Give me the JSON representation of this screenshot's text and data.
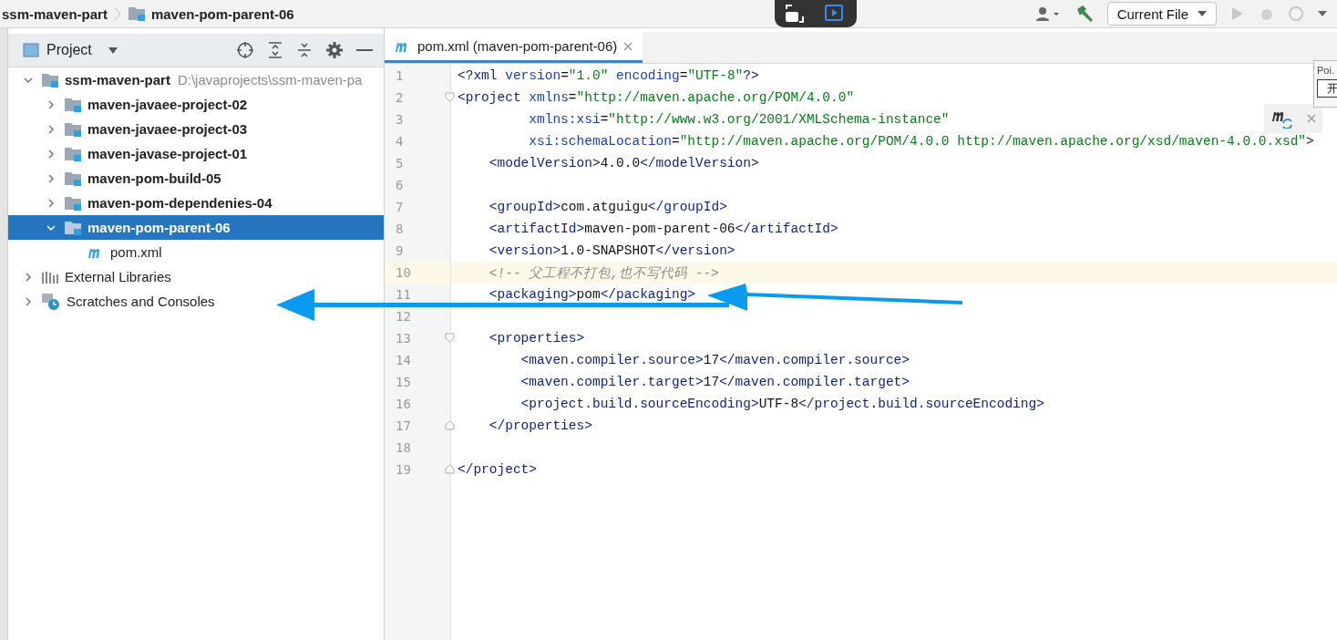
{
  "breadcrumbs": [
    {
      "label": "ssm-maven-part",
      "kind": "text"
    },
    {
      "label": "maven-pom-parent-06",
      "kind": "folder"
    }
  ],
  "toolbar": {
    "run_config": "Current File"
  },
  "project_panel": {
    "title": "Project",
    "tree": [
      {
        "label": "ssm-maven-part",
        "path": "D:\\javaprojects\\ssm-maven-pa",
        "kind": "module",
        "bold": true,
        "expanded": true,
        "selected": false,
        "children": [
          {
            "label": "maven-javaee-project-02",
            "kind": "module",
            "bold": true,
            "expanded": false,
            "selected": false
          },
          {
            "label": "maven-javaee-project-03",
            "kind": "module",
            "bold": true,
            "expanded": false,
            "selected": false
          },
          {
            "label": "maven-javase-project-01",
            "kind": "module",
            "bold": true,
            "expanded": false,
            "selected": false
          },
          {
            "label": "maven-pom-build-05",
            "kind": "module",
            "bold": true,
            "expanded": false,
            "selected": false
          },
          {
            "label": "maven-pom-dependenies-04",
            "kind": "module",
            "bold": true,
            "expanded": false,
            "selected": false
          },
          {
            "label": "maven-pom-parent-06",
            "kind": "module",
            "bold": true,
            "expanded": true,
            "selected": true,
            "children": [
              {
                "label": "pom.xml",
                "kind": "pom",
                "bold": false,
                "selected": false
              }
            ]
          }
        ]
      },
      {
        "label": "External Libraries",
        "kind": "libraries",
        "bold": false,
        "expanded": false,
        "selected": false
      },
      {
        "label": "Scratches and Consoles",
        "kind": "scratches",
        "bold": false,
        "expanded": false,
        "selected": false
      }
    ]
  },
  "editor": {
    "tab": {
      "label": "pom.xml (maven-pom-parent-06)",
      "selected": true
    },
    "lines": [
      {
        "number": "1",
        "current": false,
        "kind": "plain",
        "tokens": [
          {
            "kind": "tag",
            "text": "<?xml"
          },
          {
            "kind": "attr",
            "text": " version"
          },
          {
            "kind": "text",
            "text": "="
          },
          {
            "kind": "value",
            "text": "\"1.0\""
          },
          {
            "kind": "attr",
            "text": " encoding"
          },
          {
            "kind": "text",
            "text": "="
          },
          {
            "kind": "value",
            "text": "\"UTF-8\""
          },
          {
            "kind": "tag",
            "text": "?>"
          }
        ]
      },
      {
        "number": "2",
        "current": false,
        "kind": "fold_start",
        "tokens": [
          {
            "kind": "tag",
            "text": "<project"
          },
          {
            "kind": "attr",
            "text": " xmlns"
          },
          {
            "kind": "text",
            "text": "="
          },
          {
            "kind": "value",
            "text": "\"http://maven.apache.org/POM/4.0.0\""
          }
        ]
      },
      {
        "number": "3",
        "current": false,
        "kind": "plain",
        "tokens": [
          {
            "kind": "attr",
            "text": "         xmlns:xsi"
          },
          {
            "kind": "text",
            "text": "="
          },
          {
            "kind": "value",
            "text": "\"http://www.w3.org/2001/XMLSchema-instance\""
          }
        ]
      },
      {
        "number": "4",
        "current": false,
        "kind": "plain",
        "tokens": [
          {
            "kind": "attr",
            "text": "         xsi:schemaLocation"
          },
          {
            "kind": "text",
            "text": "="
          },
          {
            "kind": "value",
            "text": "\"http://maven.apache.org/POM/4.0.0 http://maven.apache.org/xsd/maven-4.0.0.xsd\""
          },
          {
            "kind": "tag",
            "text": ">"
          }
        ]
      },
      {
        "number": "5",
        "current": false,
        "kind": "plain",
        "tokens": [
          {
            "kind": "tag",
            "text": "    <modelVersion>"
          },
          {
            "kind": "text",
            "text": "4.0.0"
          },
          {
            "kind": "tag",
            "text": "</modelVersion>"
          }
        ]
      },
      {
        "number": "6",
        "current": false,
        "kind": "plain"
      },
      {
        "number": "7",
        "current": false,
        "kind": "plain",
        "tokens": [
          {
            "kind": "tag",
            "text": "    <groupId>"
          },
          {
            "kind": "text",
            "text": "com.atguigu"
          },
          {
            "kind": "tag",
            "text": "</groupId>"
          }
        ]
      },
      {
        "number": "8",
        "current": false,
        "kind": "plain",
        "tokens": [
          {
            "kind": "tag",
            "text": "    <artifactId>"
          },
          {
            "kind": "text",
            "text": "maven-pom-parent-06"
          },
          {
            "kind": "tag",
            "text": "</artifactId>"
          }
        ]
      },
      {
        "number": "9",
        "current": false,
        "kind": "plain",
        "tokens": [
          {
            "kind": "tag",
            "text": "    <version>"
          },
          {
            "kind": "text",
            "text": "1.0-SNAPSHOT"
          },
          {
            "kind": "tag",
            "text": "</version>"
          }
        ]
      },
      {
        "number": "10",
        "current": true,
        "kind": "plain",
        "tokens": [
          {
            "kind": "comment",
            "text": "    <!-- 父工程不打包,也不写代码 -->"
          }
        ]
      },
      {
        "number": "11",
        "current": false,
        "kind": "plain",
        "tokens": [
          {
            "kind": "tag",
            "text": "    <packaging>"
          },
          {
            "kind": "text",
            "text": "pom"
          },
          {
            "kind": "tag",
            "text": "</packaging>"
          }
        ]
      },
      {
        "number": "12",
        "current": false,
        "kind": "plain"
      },
      {
        "number": "13",
        "current": false,
        "kind": "fold_start",
        "tokens": [
          {
            "kind": "tag",
            "text": "    <properties>"
          }
        ]
      },
      {
        "number": "14",
        "current": false,
        "kind": "plain",
        "tokens": [
          {
            "kind": "tag",
            "text": "        <maven.compiler.source>"
          },
          {
            "kind": "text",
            "text": "17"
          },
          {
            "kind": "tag",
            "text": "</maven.compiler.source>"
          }
        ]
      },
      {
        "number": "15",
        "current": false,
        "kind": "plain",
        "tokens": [
          {
            "kind": "tag",
            "text": "        <maven.compiler.target>"
          },
          {
            "kind": "text",
            "text": "17"
          },
          {
            "kind": "tag",
            "text": "</maven.compiler.target>"
          }
        ]
      },
      {
        "number": "16",
        "current": false,
        "kind": "plain",
        "tokens": [
          {
            "kind": "tag",
            "text": "        <project.build.sourceEncoding>"
          },
          {
            "kind": "text",
            "text": "UTF-8"
          },
          {
            "kind": "tag",
            "text": "</project.build.sourceEncoding>"
          }
        ]
      },
      {
        "number": "17",
        "current": false,
        "kind": "fold_end",
        "tokens": [
          {
            "kind": "tag",
            "text": "    </properties>"
          }
        ]
      },
      {
        "number": "18",
        "current": false,
        "kind": "plain"
      },
      {
        "number": "19",
        "current": false,
        "kind": "fold_end",
        "tokens": [
          {
            "kind": "tag",
            "text": "</project>"
          }
        ]
      }
    ]
  },
  "side_popup": {
    "title": "Poi.",
    "button": "开"
  }
}
